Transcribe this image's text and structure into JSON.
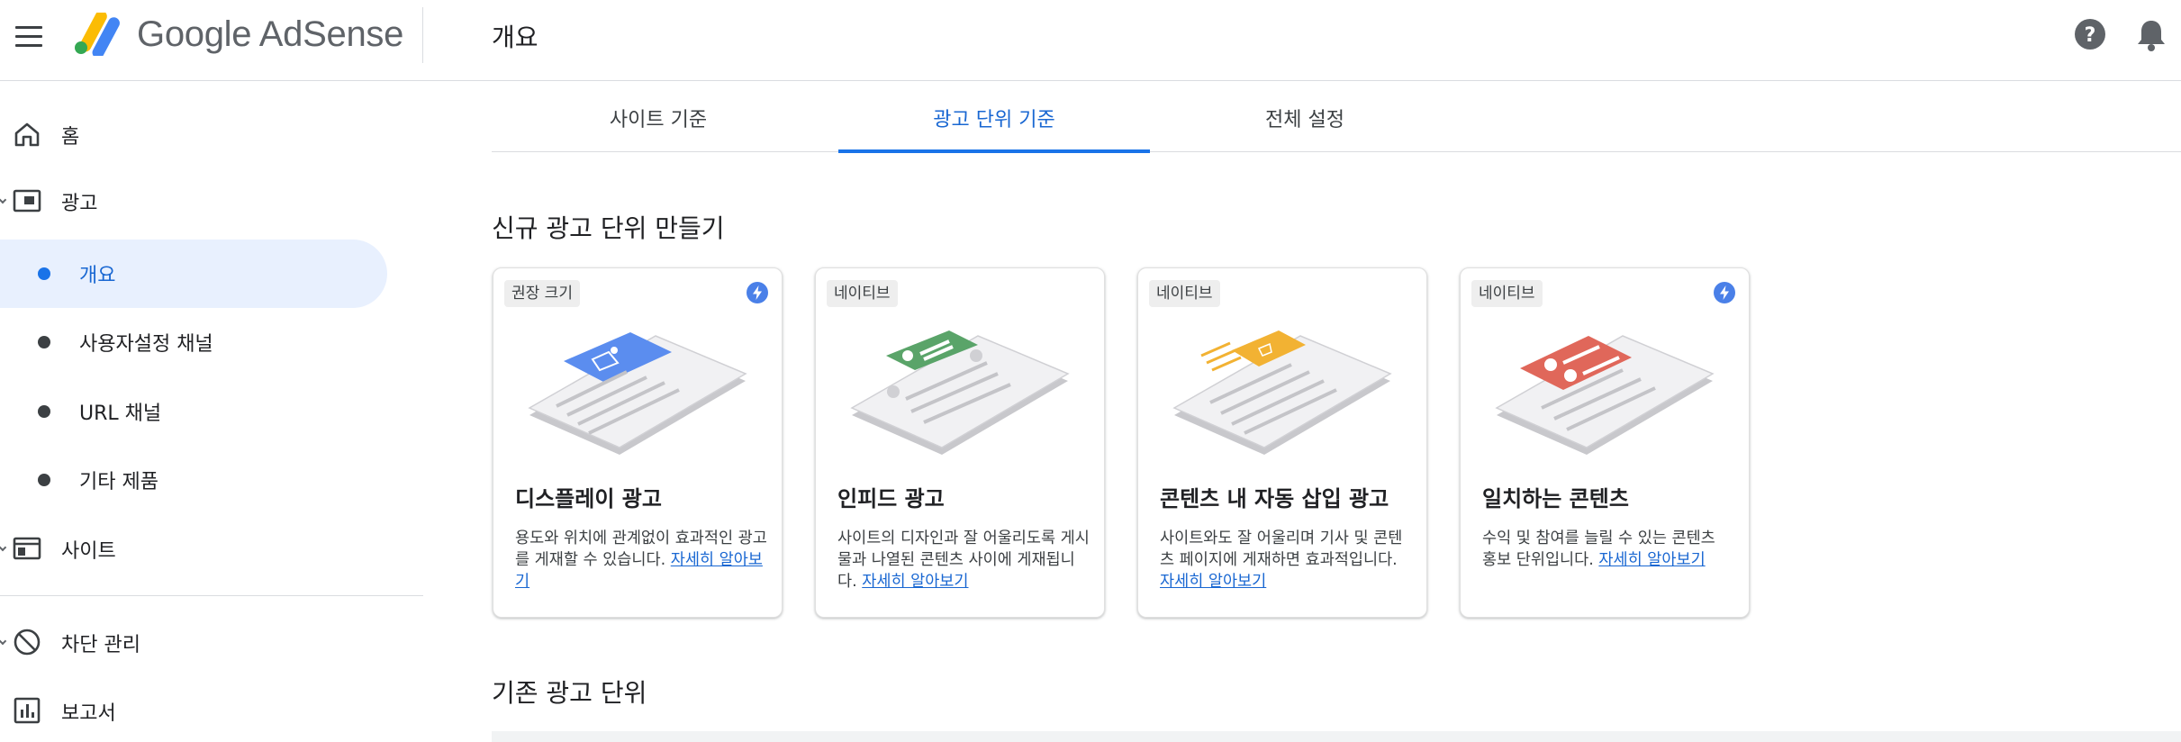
{
  "header": {
    "logo_text": "Google AdSense",
    "page_title": "개요"
  },
  "sidebar": {
    "items": [
      {
        "label": "홈",
        "icon": "home-icon"
      },
      {
        "label": "광고",
        "icon": "ads-icon"
      },
      {
        "label": "사이트",
        "icon": "sites-icon"
      },
      {
        "label": "차단 관리",
        "icon": "block-icon"
      },
      {
        "label": "보고서",
        "icon": "reports-icon"
      }
    ],
    "sub_items": [
      {
        "label": "개요",
        "active": true
      },
      {
        "label": "사용자설정 채널"
      },
      {
        "label": "URL 채널"
      },
      {
        "label": "기타 제품"
      }
    ]
  },
  "tabs": [
    {
      "label": "사이트 기준"
    },
    {
      "label": "광고 단위 기준",
      "active": true
    },
    {
      "label": "전체 설정"
    }
  ],
  "sections": {
    "create_title": "신규 광고 단위 만들기",
    "existing_title": "기존 광고 단위"
  },
  "cards": [
    {
      "badge": "권장 크기",
      "title": "디스플레이 광고",
      "desc": "용도와 위치에 관계없이 효과적인 광고를 게재할 수 있습니다.",
      "link": "자세히 알아보기",
      "lightning": true,
      "accent": "#5b8def"
    },
    {
      "badge": "네이티브",
      "title": "인피드 광고",
      "desc": "사이트의 디자인과 잘 어울리도록 게시물과 나열된 콘텐츠 사이에 게재됩니다.",
      "link": "자세히 알아보기",
      "lightning": false,
      "accent": "#5aa469"
    },
    {
      "badge": "네이티브",
      "title": "콘텐츠 내 자동 삽입 광고",
      "desc": "사이트와도 잘 어울리며 기사 및 콘텐츠 페이지에 게재하면 효과적입니다.",
      "link": "자세히 알아보기",
      "lightning": false,
      "accent": "#f2b233"
    },
    {
      "badge": "네이티브",
      "title": "일치하는 콘텐츠",
      "desc": "수익 및 참여를 늘릴 수 있는 콘텐츠 홍보 단위입니다.",
      "link": "자세히 알아보기",
      "lightning": true,
      "accent": "#e0675a"
    }
  ],
  "colors": {
    "primary": "#1a73e8",
    "active_bg": "#e8f0fe"
  }
}
